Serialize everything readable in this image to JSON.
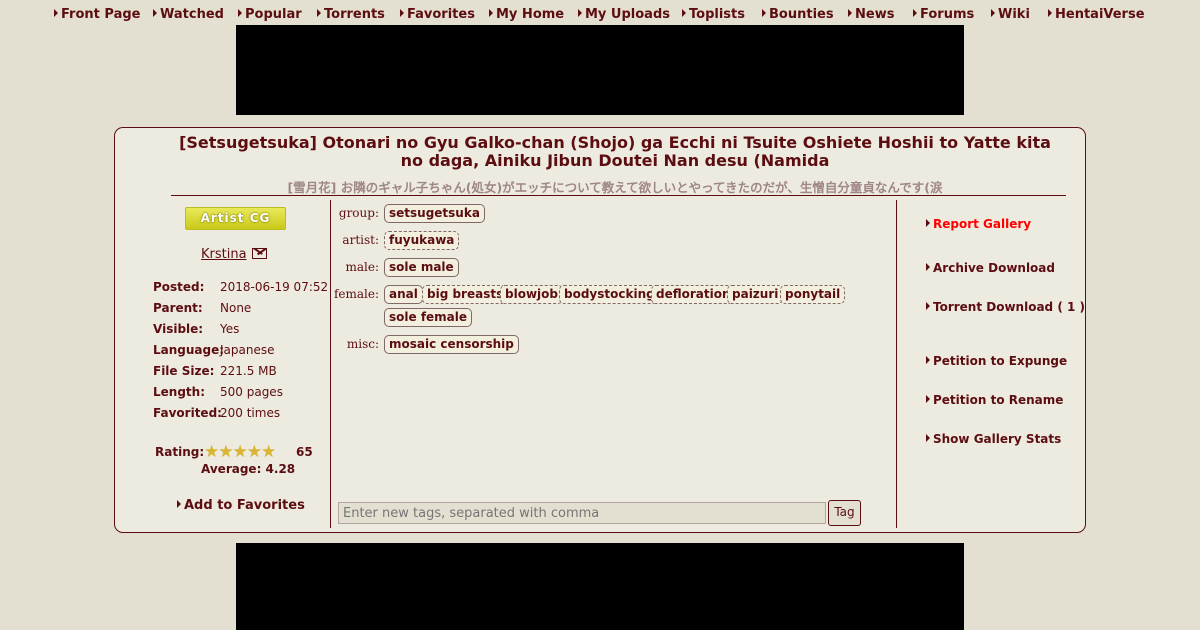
{
  "nav": [
    "Front Page",
    "Watched",
    "Popular",
    "Torrents",
    "Favorites",
    "My Home",
    "My Uploads",
    "Toplists",
    "Bounties",
    "News",
    "Forums",
    "Wiki",
    "HentaiVerse"
  ],
  "gallery": {
    "title": "[Setsugetsuka] Otonari no Gyu Galko-chan (Shojo) ga Ecchi ni Tsuite Oshiete Hoshii to Yatte kita no daga, Ainiku Jibun Doutei Nan desu (Namida",
    "title_jpn": "[雪月花] お隣のギャル子ちゃん(処女)がエッチについて教えて欲しいとやってきたのだが、生憎自分童貞なんです(涙",
    "category": "Artist CG",
    "uploader": "Krstina",
    "details": [
      {
        "key": "Posted:",
        "value": "2018-06-19 07:52"
      },
      {
        "key": "Parent:",
        "value": "None"
      },
      {
        "key": "Visible:",
        "value": "Yes"
      },
      {
        "key": "Language:",
        "value": "Japanese"
      },
      {
        "key": "File Size:",
        "value": "221.5 MB"
      },
      {
        "key": "Length:",
        "value": "500 pages"
      },
      {
        "key": "Favorited:",
        "value": "200 times"
      }
    ],
    "rating": {
      "label": "Rating:",
      "count": "65",
      "average_text": "Average: 4.28",
      "value": 4.28,
      "max": 5
    },
    "add_favorites": "Add to Favorites"
  },
  "tags": {
    "group": {
      "label": "group:",
      "tags": [
        "setsugetsuka"
      ]
    },
    "artist": {
      "label": "artist:",
      "tags": [
        "fuyukawa"
      ]
    },
    "male": {
      "label": "male:",
      "tags": [
        "sole male"
      ]
    },
    "female": {
      "label": "female:",
      "tags": [
        "anal",
        "big breasts",
        "blowjob",
        "bodystocking",
        "defloration",
        "paizuri",
        "ponytail",
        "sole female"
      ]
    },
    "misc": {
      "label": "misc:",
      "tags": [
        "mosaic censorship"
      ]
    },
    "input_placeholder": "Enter new tags, separated with comma",
    "button": "Tag"
  },
  "actions": [
    "Report Gallery",
    "Archive Download",
    "Torrent Download ( 1 )",
    "Petition to Expunge",
    "Petition to Rename",
    "Show Gallery Stats"
  ],
  "colors": {
    "accent": "#5c0d11",
    "background": "#e3e0d1",
    "panel": "#edebdf",
    "report": "#ff0000",
    "star": "#d9b531"
  }
}
